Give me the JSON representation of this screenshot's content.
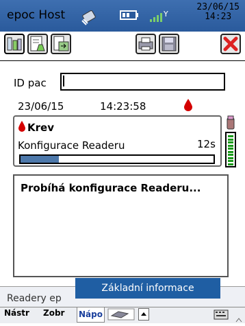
{
  "titlebar": {
    "title": "epoc Host",
    "date": "23/06/15",
    "time": "14:23"
  },
  "toolbar": {
    "icons": [
      "lab-flasks-icon",
      "document-flask-icon",
      "document-arrow-icon",
      "printer-icon",
      "save-disk-icon",
      "close-x-icon"
    ]
  },
  "patient": {
    "id_label": "ID pac",
    "id_value": "",
    "date": "23/06/15",
    "time": "14:23:58"
  },
  "sample": {
    "name": "Krev",
    "config_label": "Konfigurace Readeru",
    "config_time": "12s",
    "progress": 0.2
  },
  "message": "Probíhá konfigurace Readeru...",
  "bottom": {
    "readers_label": "Readery ep",
    "tooltip": "Základní informace",
    "menu": [
      "Nástr",
      "Zobr",
      "Nápo"
    ]
  },
  "colors": {
    "titlebar": "#2a5a9c",
    "drop": "#d40000",
    "progress": "#4d78aa",
    "battery": "#1a9a1a"
  }
}
